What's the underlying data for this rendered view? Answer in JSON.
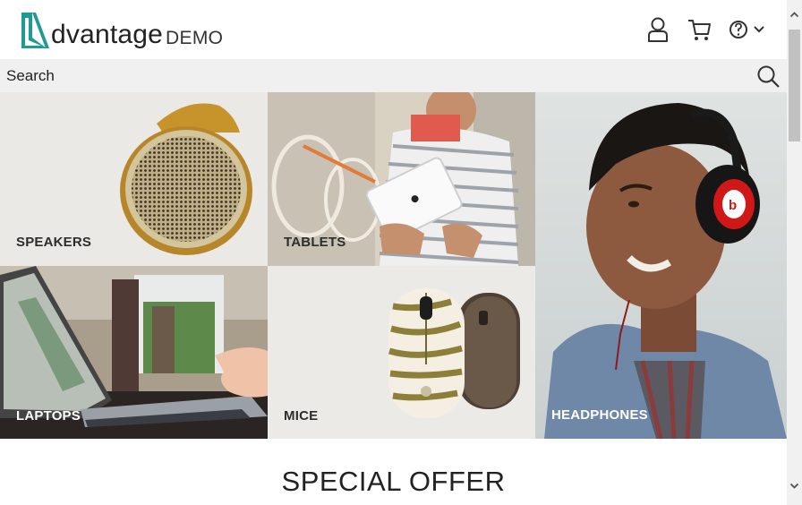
{
  "header": {
    "logo_word": "dvantage",
    "logo_demo": "DEMO",
    "icons": [
      "user-icon",
      "cart-icon",
      "help-icon",
      "chevron-down-icon"
    ]
  },
  "search": {
    "placeholder": "Search"
  },
  "categories": [
    {
      "label": "SPEAKERS"
    },
    {
      "label": "TABLETS"
    },
    {
      "label": "HEADPHONES"
    },
    {
      "label": "LAPTOPS"
    },
    {
      "label": "MICE"
    }
  ],
  "special_offer": {
    "title": "SPECIAL OFFER"
  },
  "colors": {
    "brand_teal": "#1e9c91",
    "search_bg": "#f0f0f0"
  }
}
